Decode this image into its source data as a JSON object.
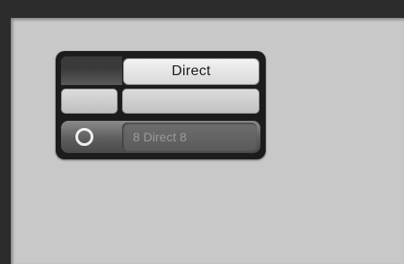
{
  "widget": {
    "header_label": "Direct",
    "channel_value": "8 Direct 8"
  },
  "icons": {
    "selector": "radio-circle-icon"
  },
  "colors": {
    "screen_bg": "#c8c8c8",
    "widget_bg": "#1c1c1c",
    "frame": "#2c2c2c"
  }
}
